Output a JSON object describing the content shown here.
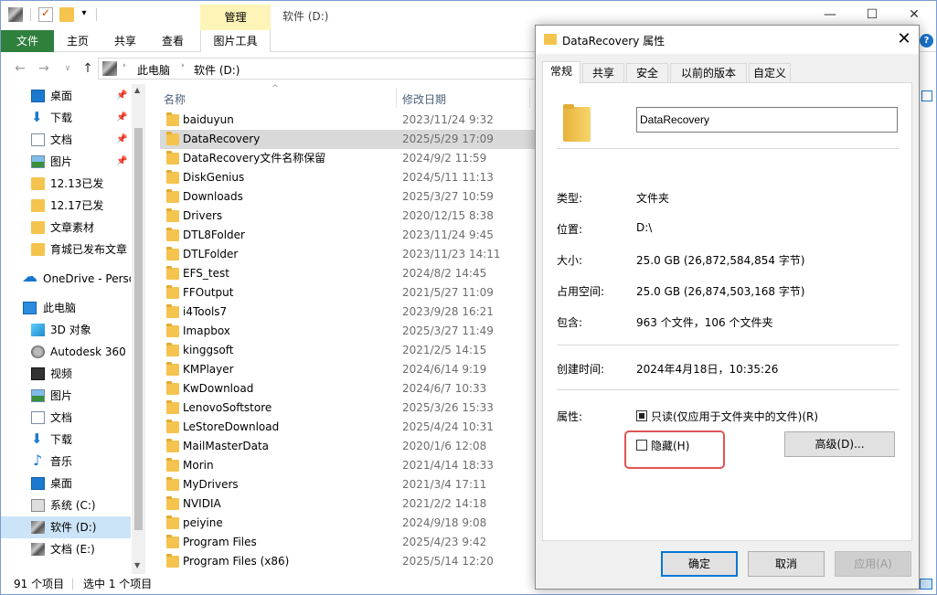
{
  "window": {
    "title": "软件 (D:)",
    "context_tab": "管理",
    "controls": {
      "minimize": "—",
      "maximize": "☐",
      "close": "✕"
    }
  },
  "ribbon": {
    "tabs": [
      "文件",
      "主页",
      "共享",
      "查看",
      "图片工具"
    ],
    "help": "?"
  },
  "address": {
    "crumbs": [
      "此电脑",
      "软件 (D:)"
    ]
  },
  "nav": {
    "items": [
      {
        "label": "桌面",
        "icon": "desktop-icon",
        "pinned": true
      },
      {
        "label": "下载",
        "icon": "download-icon",
        "pinned": true
      },
      {
        "label": "文档",
        "icon": "document-icon",
        "pinned": true
      },
      {
        "label": "图片",
        "icon": "picture-icon",
        "pinned": true
      },
      {
        "label": "12.13已发",
        "icon": "folder-icon",
        "pinned": false
      },
      {
        "label": "12.17已发",
        "icon": "folder-icon",
        "pinned": false
      },
      {
        "label": "文章素材",
        "icon": "folder-icon",
        "pinned": false
      },
      {
        "label": "育城已发布文章",
        "icon": "folder-icon",
        "pinned": false
      },
      {
        "label": "OneDrive - Perso",
        "icon": "onedrive-icon",
        "pinned": false
      },
      {
        "label": "此电脑",
        "icon": "this-pc-icon",
        "pinned": false
      },
      {
        "label": "3D 对象",
        "icon": "3d-objects-icon",
        "pinned": false
      },
      {
        "label": "Autodesk 360",
        "icon": "autodesk-icon",
        "pinned": false
      },
      {
        "label": "视频",
        "icon": "video-icon",
        "pinned": false
      },
      {
        "label": "图片",
        "icon": "picture-icon",
        "pinned": false
      },
      {
        "label": "文档",
        "icon": "document-icon",
        "pinned": false
      },
      {
        "label": "下载",
        "icon": "download-icon",
        "pinned": false
      },
      {
        "label": "音乐",
        "icon": "music-icon",
        "pinned": false
      },
      {
        "label": "桌面",
        "icon": "desktop-icon",
        "pinned": false
      },
      {
        "label": "系统 (C:)",
        "icon": "drive-icon",
        "pinned": false
      },
      {
        "label": "软件 (D:)",
        "icon": "drive-icon",
        "pinned": false,
        "selected": true
      },
      {
        "label": "文档 (E:)",
        "icon": "drive-icon",
        "pinned": false
      }
    ]
  },
  "filelist": {
    "columns": {
      "name": "名称",
      "date": "修改日期"
    },
    "rows": [
      {
        "name": "baiduyun",
        "date": "2023/11/24 9:32"
      },
      {
        "name": "DataRecovery",
        "date": "2025/5/29 17:09",
        "selected": true
      },
      {
        "name": "DataRecovery文件名称保留",
        "date": "2024/9/2 11:59"
      },
      {
        "name": "DiskGenius",
        "date": "2024/5/11 11:13"
      },
      {
        "name": "Downloads",
        "date": "2025/3/27 10:59"
      },
      {
        "name": "Drivers",
        "date": "2020/12/15 8:38"
      },
      {
        "name": "DTL8Folder",
        "date": "2023/11/24 9:45"
      },
      {
        "name": "DTLFolder",
        "date": "2023/11/23 14:11"
      },
      {
        "name": "EFS_test",
        "date": "2024/8/2 14:45"
      },
      {
        "name": "FFOutput",
        "date": "2021/5/27 11:09"
      },
      {
        "name": "i4Tools7",
        "date": "2023/9/28 16:21"
      },
      {
        "name": "Imapbox",
        "date": "2025/3/27 11:49"
      },
      {
        "name": "kinggsoft",
        "date": "2021/2/5 14:15"
      },
      {
        "name": "KMPlayer",
        "date": "2024/6/14 9:19"
      },
      {
        "name": "KwDownload",
        "date": "2024/6/7 10:33"
      },
      {
        "name": "LenovoSoftstore",
        "date": "2025/3/26 15:33"
      },
      {
        "name": "LeStoreDownload",
        "date": "2025/4/24 10:31"
      },
      {
        "name": "MailMasterData",
        "date": "2020/1/6 12:08"
      },
      {
        "name": "Morin",
        "date": "2021/4/14 18:33"
      },
      {
        "name": "MyDrivers",
        "date": "2021/3/4 17:11"
      },
      {
        "name": "NVIDIA",
        "date": "2021/2/2 14:18"
      },
      {
        "name": "peiyine",
        "date": "2024/9/18 9:08"
      },
      {
        "name": "Program Files",
        "date": "2025/4/23 9:42"
      },
      {
        "name": "Program Files (x86)",
        "date": "2025/5/14 12:20"
      }
    ]
  },
  "status": {
    "count": "91 个项目",
    "selected": "选中 1 个项目"
  },
  "dialog": {
    "title": "DataRecovery 属性",
    "close": "✕",
    "tabs": [
      "常规",
      "共享",
      "安全",
      "以前的版本",
      "自定义"
    ],
    "name": "DataRecovery",
    "properties": [
      {
        "label": "类型:",
        "value": "文件夹"
      },
      {
        "label": "位置:",
        "value": "D:\\"
      },
      {
        "label": "大小:",
        "value": "25.0 GB (26,872,584,854 字节)"
      },
      {
        "label": "占用空间:",
        "value": "25.0 GB (26,874,503,168 字节)"
      },
      {
        "label": "包含:",
        "value": "963 个文件，106 个文件夹"
      }
    ],
    "created_label": "创建时间:",
    "created_value": "2024年4月18日，10:35:26",
    "attributes_label": "属性:",
    "readonly_label": "只读(仅应用于文件夹中的文件)(R)",
    "hidden_label": "隐藏(H)",
    "advanced_label": "高级(D)...",
    "ok_label": "确定",
    "cancel_label": "取消",
    "apply_label": "应用(A)"
  }
}
